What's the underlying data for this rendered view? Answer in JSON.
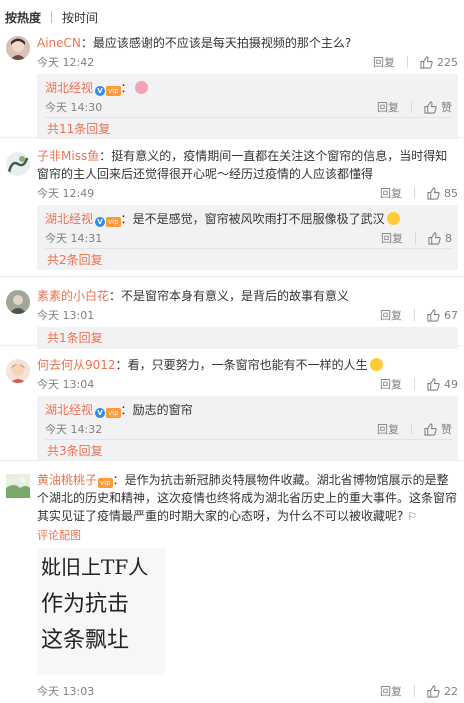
{
  "sort": {
    "hot": "按热度",
    "time": "按时间"
  },
  "comments": [
    {
      "user": "AineCN",
      "sep": "：",
      "text": "最应该感谢的不应该是每天拍摄视频的那个主么?",
      "time": "今天 12:42",
      "reply": "回复",
      "likes": "225",
      "sub": [
        {
          "user": "湖北经视",
          "sep": "：",
          "text": "",
          "time": "今天 14:30",
          "reply": "回复",
          "likes": "赞"
        }
      ],
      "more": "共11条回复"
    },
    {
      "user": "子非Miss鱼",
      "sep": "：",
      "text": "挺有意义的，疫情期间一直都在关注这个窗帘的信息，当时得知窗帘的主人回来后还觉得很开心呢～经历过疫情的人应该都懂得",
      "time": "今天 12:49",
      "reply": "回复",
      "likes": "85",
      "sub": [
        {
          "user": "湖北经视",
          "sep": "：",
          "text": "是不是感觉，窗帘被风吹雨打不屈服像极了武汉",
          "time": "今天 14:31",
          "reply": "回复",
          "likes": "8"
        }
      ],
      "more": "共2条回复"
    },
    {
      "user": "素素的小白花",
      "sep": "：",
      "text": "不是窗帘本身有意义，是背后的故事有意义",
      "time": "今天 13:01",
      "reply": "回复",
      "likes": "67",
      "sub": [],
      "more": "共1条回复"
    },
    {
      "user": "何去何从9012",
      "sep": "：",
      "text": "看，只要努力，一条窗帘也能有不一样的人生",
      "time": "今天 13:04",
      "reply": "回复",
      "likes": "49",
      "sub": [
        {
          "user": "湖北经视",
          "sep": "：",
          "text": "励志的窗帘",
          "time": "今天 14:32",
          "reply": "回复",
          "likes": "赞"
        }
      ],
      "more": "共3条回复"
    },
    {
      "user": "黄油桃桃子",
      "sep": "：",
      "text": "是作为抗击新冠肺炎特展物件收藏。湖北省博物馆展示的是整个湖北的历史和精神，这次疫情也终将成为湖北省历史上的重大事件。这条窗帘其实见证了疫情最严重的时期大家的心态呀，为什么不可以被收藏呢?",
      "pic_link": "评论配图",
      "pic_lines": [
        "妣旧上TF人",
        "作为抗击",
        "这条飘圵"
      ],
      "time": "今天 13:03",
      "reply": "回复",
      "likes": "22"
    }
  ],
  "colors": {
    "username": "#eb7350",
    "meta": "#808080",
    "subbox": "#f2f2f5"
  }
}
